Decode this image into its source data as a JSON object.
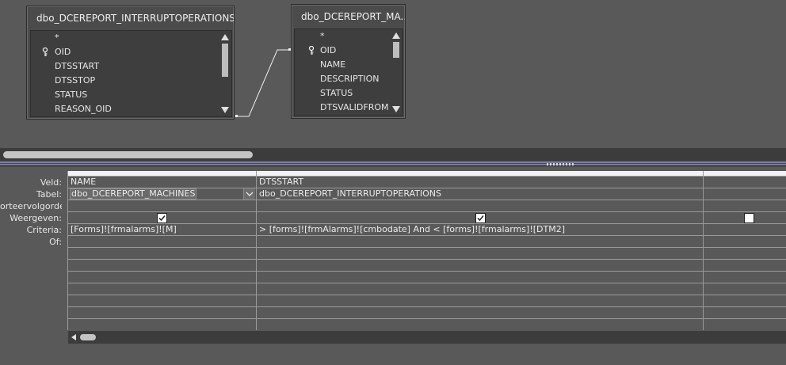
{
  "diagram": {
    "tables": [
      {
        "title": "dbo_DCEREPORT_INTERRUPTOPERATIONS",
        "fields": [
          "*",
          "OID",
          "DTSSTART",
          "DTSSTOP",
          "STATUS",
          "REASON_OID"
        ],
        "key_field": "OID"
      },
      {
        "title": "dbo_DCEREPORT_MA...",
        "fields": [
          "*",
          "OID",
          "NAME",
          "DESCRIPTION",
          "STATUS",
          "DTSVALIDFROM"
        ],
        "key_field": "OID"
      }
    ]
  },
  "grid": {
    "row_labels": [
      "Veld:",
      "Tabel:",
      "orteervolgorde:",
      "Weergeven:",
      "Criteria:",
      "Of:"
    ],
    "columns": [
      {
        "field": "NAME",
        "table": "dbo_DCEREPORT_MACHINES",
        "show": true,
        "criteria": "[Forms]![frmalarms]![M]"
      },
      {
        "field": "DTSSTART",
        "table": "dbo_DCEREPORT_INTERRUPTOPERATIONS",
        "show": true,
        "criteria": "> [forms]![frmAlarms]![cmbodate] And < [forms]![frmalarms]![DTM2]"
      },
      {
        "field": "",
        "table": "",
        "show": false,
        "criteria": ""
      }
    ]
  },
  "icons": {
    "key": "key-icon",
    "check": "checkmark-icon",
    "dropdown": "chevron-down-icon"
  },
  "colors": {
    "background": "#595959",
    "panel": "#4b4b4b",
    "splitter_accent": "#7b7cb0"
  }
}
